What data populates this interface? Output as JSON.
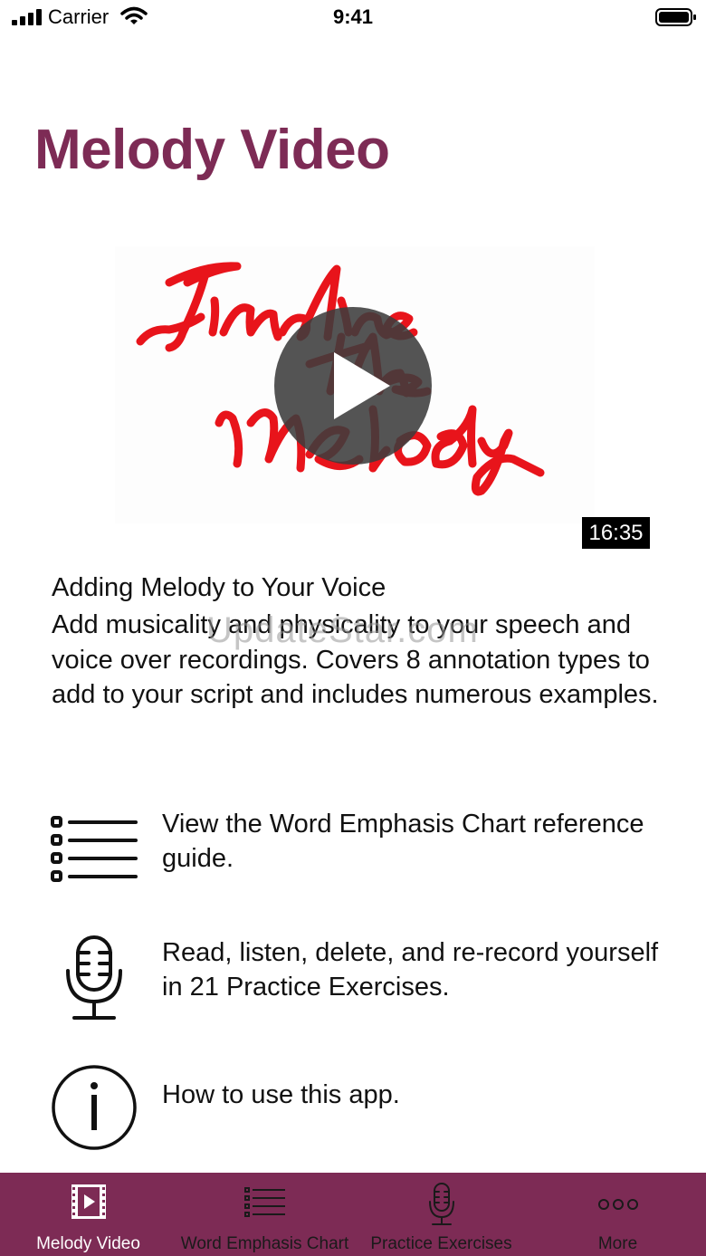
{
  "status_bar": {
    "carrier": "Carrier",
    "time": "9:41"
  },
  "page": {
    "title": "Melody Video"
  },
  "video": {
    "duration": "16:35",
    "title": "Adding Melody to Your Voice",
    "description": "Add musicality and physicality to your speech and voice over recordings.  Covers 8 annotation types to add to your script and includes numerous examples.",
    "watermark": "UpdateStar.com"
  },
  "menu": {
    "items": [
      {
        "icon": "list-icon",
        "text": "View the Word Emphasis Chart reference guide."
      },
      {
        "icon": "microphone-icon",
        "text": "Read, listen, delete, and re-record yourself in 21 Practice Exercises."
      },
      {
        "icon": "info-icon",
        "text": "How to use this app."
      }
    ]
  },
  "tab_bar": {
    "tabs": [
      {
        "label": "Melody Video",
        "icon": "film-icon",
        "active": true
      },
      {
        "label": "Word Emphasis Chart",
        "icon": "list-icon",
        "active": false
      },
      {
        "label": "Practice Exercises",
        "icon": "microphone-icon",
        "active": false
      },
      {
        "label": "More",
        "icon": "more-icon",
        "active": false
      }
    ]
  },
  "colors": {
    "brand": "#7d2b55",
    "script_red": "#e8141b",
    "tab_active": "#ffffff",
    "tab_inactive": "#1a1a1a"
  }
}
